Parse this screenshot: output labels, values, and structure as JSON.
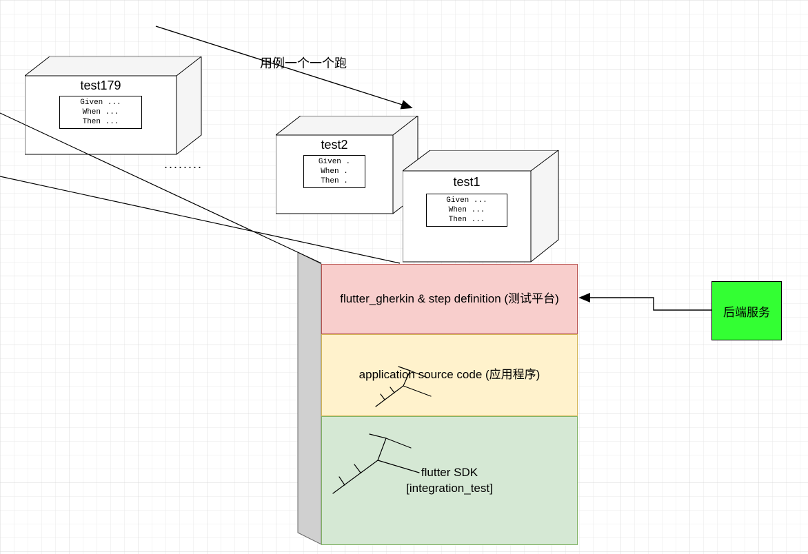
{
  "top_label": "用例一个一个跑",
  "ellipsis": "........",
  "tests": {
    "test179": {
      "title": "test179",
      "given": "Given ...",
      "when": "When ...",
      "then": "Then ..."
    },
    "test2": {
      "title": "test2",
      "given": "Given .",
      "when": "When .",
      "then": "Then ."
    },
    "test1": {
      "title": "test1",
      "given": "Given ...",
      "when": "When ...",
      "then": "Then ..."
    }
  },
  "stack": {
    "layer1": "flutter_gherkin & step definition (测试平台)",
    "layer2": "application source code (应用程序)",
    "layer3_line1": "flutter SDK",
    "layer3_line2": "[integration_test]"
  },
  "backend": "后端服务"
}
